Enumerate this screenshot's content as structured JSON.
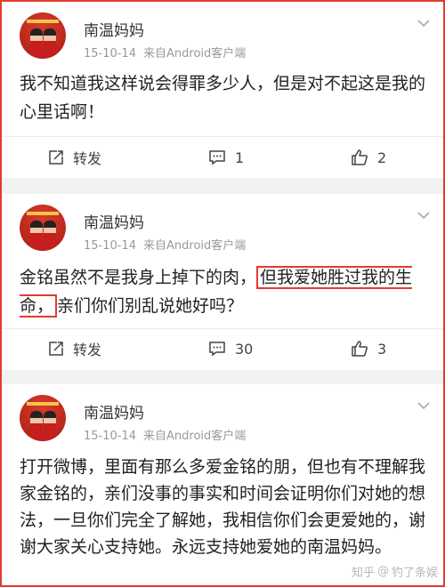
{
  "posts": [
    {
      "author": "南温妈妈",
      "date": "15-10-14",
      "source": "来自Android客户端",
      "text_before": "我不知道我这样说会得罪多少人，但是对不起这是我的心里话啊！",
      "highlight": "",
      "text_after": "",
      "repost_label": "转发",
      "comment_count": "1",
      "like_count": "2"
    },
    {
      "author": "南温妈妈",
      "date": "15-10-14",
      "source": "来自Android客户端",
      "text_before": "金铭虽然不是我身上掉下的肉，",
      "highlight": "但我爱她胜过我的生命，",
      "text_after": "亲们你们别乱说她好吗？",
      "repost_label": "转发",
      "comment_count": "30",
      "like_count": "3"
    },
    {
      "author": "南温妈妈",
      "date": "15-10-14",
      "source": "来自Android客户端",
      "text_before": "打开微博，里面有那么多爱金铭的朋，但也有不理解我家金铭的，亲们没事的事实和时间会证明你们对她的想法，一旦你们完全了解她，我相信你们会更爱她的，谢谢大家关心支持她。永远支持她爱她的南温妈妈。",
      "highlight": "",
      "text_after": ""
    }
  ],
  "watermark": {
    "site": "知乎",
    "at": "@",
    "user": "钓了条娱"
  },
  "colors": {
    "accent_red": "#e33b2f",
    "meta_gray": "#999999"
  }
}
